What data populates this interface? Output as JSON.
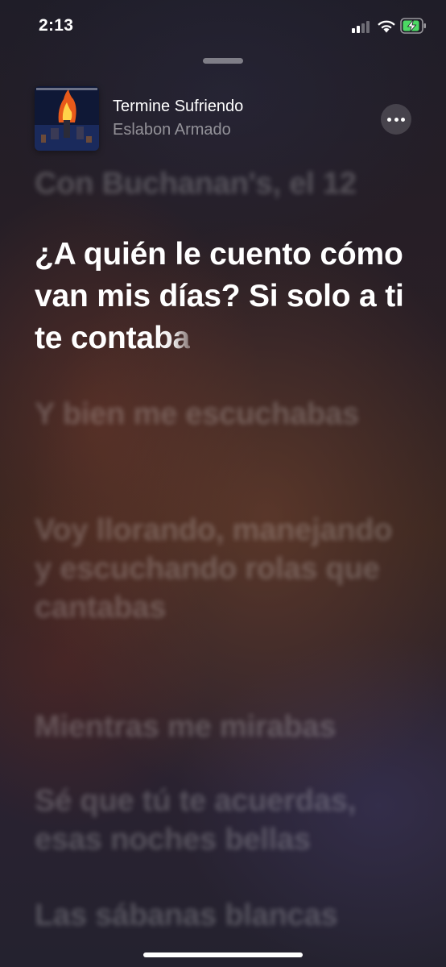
{
  "status_bar": {
    "time": "2:13",
    "icons": [
      "cellular-signal-icon",
      "wifi-icon",
      "battery-charging-icon"
    ],
    "battery_color": "#4cd964"
  },
  "now_playing": {
    "title": "Termine Sufriendo",
    "artist": "Eslabon Armado",
    "more_icon": "ellipsis-icon"
  },
  "lyrics": {
    "previous": "Con Buchanan's, el 12",
    "current_sung": "¿A quién le cuento cómo van mis días? Si solo a ti te conta",
    "current_rest": "ba",
    "upcoming": [
      "Y bien me escuchabas",
      "Voy llorando, manejando y escuchando rolas que cantabas",
      "Mientras me mirabas",
      "Sé que tú te acuerdas, esas noches bellas",
      "Las sábanas blancas"
    ]
  },
  "colors": {
    "accent_text": "#ffffff",
    "secondary_text": "rgba(255,255,255,0.5)"
  }
}
